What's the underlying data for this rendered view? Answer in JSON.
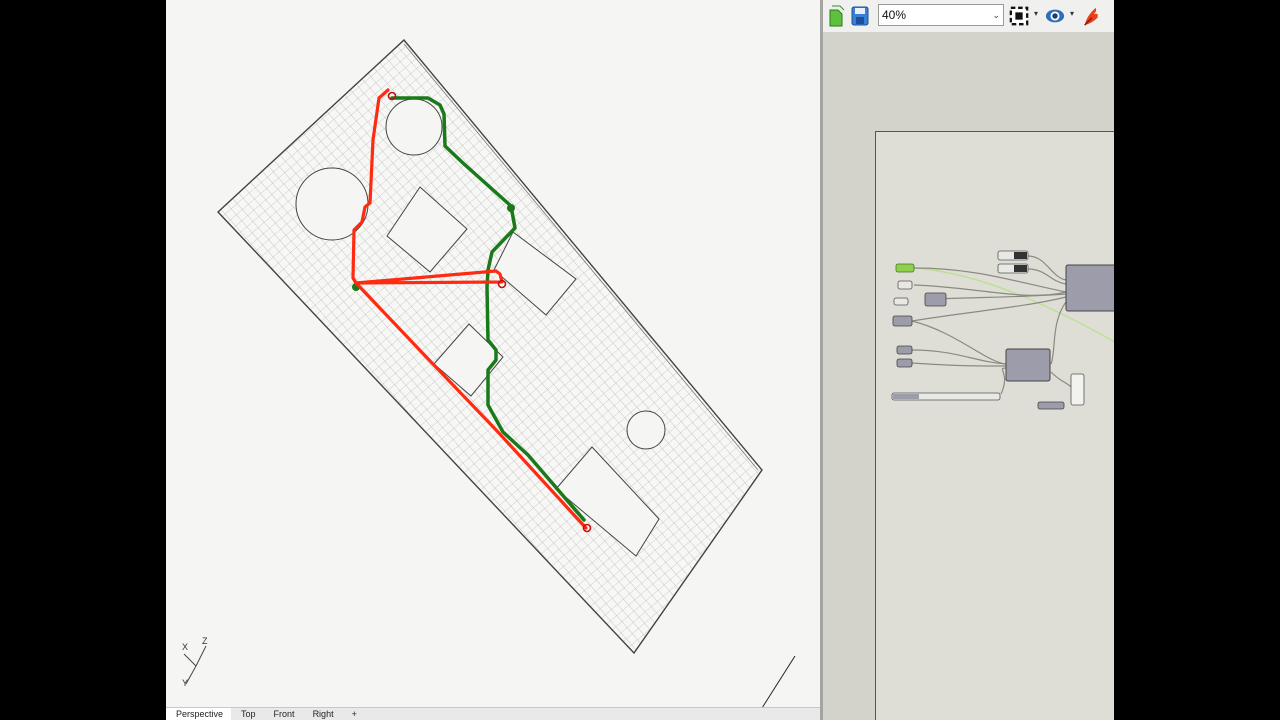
{
  "viewport": {
    "name": "Rhino Perspective viewport",
    "tabs": [
      "Perspective",
      "Top",
      "Front",
      "Right"
    ],
    "tab_suffix": "+",
    "axes": {
      "x": "X",
      "y": "Y",
      "z": "Z"
    },
    "colors": {
      "grid": "#9a9a9a",
      "background": "#f5f6f4",
      "red_path": "#ff2a10",
      "green_path": "#1a7a1a"
    }
  },
  "grasshopper": {
    "zoom": "40%",
    "icons": [
      "open-file-icon",
      "save-file-icon",
      "zoom-extents-icon",
      "preview-eye-icon",
      "sketch-pen-icon"
    ],
    "colors": {
      "canvas": "#deded6",
      "component": "#9c9cab",
      "selected_param": "#8fd14f"
    }
  }
}
